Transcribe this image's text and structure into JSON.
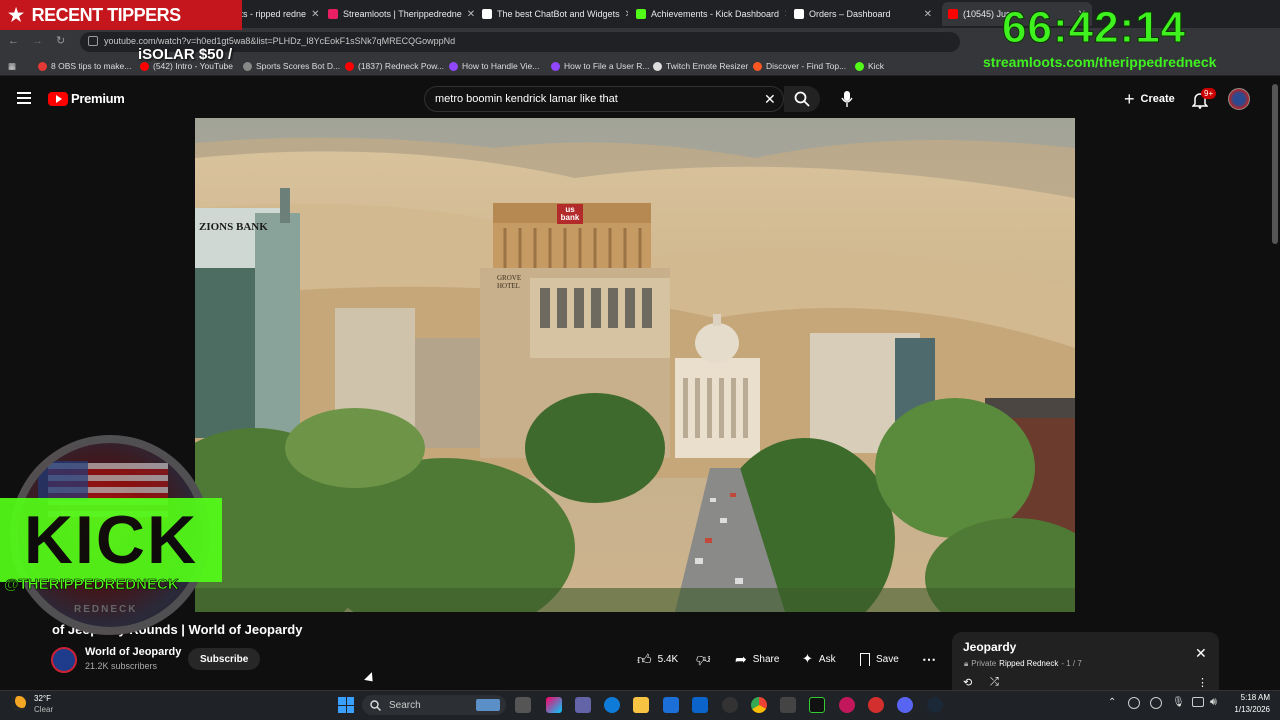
{
  "tabs": [
    {
      "label": "StreamElements - ripped redne",
      "color": "#e53935"
    },
    {
      "label": "Streamloots | Therippedredne",
      "color": "#e91e63"
    },
    {
      "label": "The best ChatBot and Widgets",
      "color": "#ffffff"
    },
    {
      "label": "Achievements - Kick Dashboard",
      "color": "#53fc18"
    },
    {
      "label": "Orders – Dashboard",
      "color": "#ffffff"
    },
    {
      "label": "(10545) Jus",
      "color": "#ff0000"
    }
  ],
  "address_bar": {
    "url": "youtube.com/watch?v=h0ed1gt5wa8&list=PLHDz_I8YcEokF1sSNk7qMRECQGowppNd"
  },
  "bookmarks": [
    {
      "label": "8 OBS tips to make...",
      "color": "#e53935"
    },
    {
      "label": "(542) Intro - YouTube",
      "color": "#ff0000"
    },
    {
      "label": "Sports Scores Bot D...",
      "color": "#888888"
    },
    {
      "label": "(1837) Redneck Pow...",
      "color": "#ff0000"
    },
    {
      "label": "How to Handle Vie...",
      "color": "#9146ff"
    },
    {
      "label": "How to File a User R...",
      "color": "#9146ff"
    },
    {
      "label": "Twitch Emote Resizer",
      "color": "#dddddd"
    },
    {
      "label": "Discover - Find Top...",
      "color": "#ff5722"
    },
    {
      "label": "Kick",
      "color": "#53fc18"
    }
  ],
  "youtube": {
    "logo_text": "Premium",
    "search_value": "metro boomin kendrick lamar like that",
    "create_label": "Create",
    "notif_badge": "9+"
  },
  "video": {
    "title": "Jeopardy Rounds | World of Jeopardy",
    "title_visible_tail": "of Jeopardy Rounds | World of Jeopardy",
    "channel": "World of Jeopardy",
    "subscribers": "21.2K subscribers",
    "subscribe_label": "Subscribe",
    "likes": "5.4K",
    "share_label": "Share",
    "ask_label": "Ask",
    "save_label": "Save",
    "building_signs": {
      "zions": "ZIONS BANK",
      "usbank": "us bank",
      "grove": "GROVE HOTEL"
    }
  },
  "playlist": {
    "title": "Jeopardy",
    "meta_privacy": "Private",
    "meta_owner": "Ripped Redneck",
    "meta_position": "- 1 / 7"
  },
  "overlay": {
    "recent_tippers": "RECENT TIPPERS",
    "tipper_entry": "iSOLAR $50 /",
    "timer": "66:42:14",
    "stream_url": "streamloots.com/therippedredneck",
    "kick_text": "KICK",
    "kick_handle": "@THERIPPEDREDNECK",
    "badge_text": "REDNECK"
  },
  "taskbar": {
    "weather_temp": "32°F",
    "weather_cond": "Clear",
    "search_placeholder": "Search",
    "time": "5:18 AM",
    "date": "1/13/2026"
  }
}
